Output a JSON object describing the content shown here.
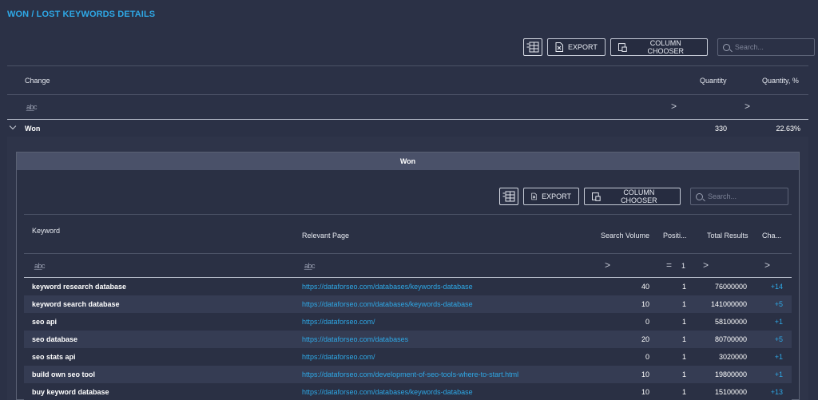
{
  "title": "WON / LOST KEYWORDS DETAILS",
  "outer_toolbar": {
    "export_label": "EXPORT",
    "column_chooser_label": "COLUMN CHOOSER",
    "search_placeholder": "Search..."
  },
  "outer_grid": {
    "columns": {
      "change": "Change",
      "quantity": "Quantity",
      "quantity_pct": "Quantity, %"
    },
    "filter_text_glyph": "a̲b̲c",
    "op_glyph": ">",
    "group": {
      "label": "Won",
      "quantity": "330",
      "quantity_pct": "22.63%"
    }
  },
  "detail": {
    "panel_title": "Won",
    "toolbar": {
      "export_label": "EXPORT",
      "column_chooser_label": "COLUMN CHOOSER",
      "search_placeholder": "Search..."
    },
    "columns": {
      "keyword": "Keyword",
      "relevant_page": "Relevant Page",
      "search_volume": "Search Volume",
      "position": "Positi...",
      "total_results": "Total Results",
      "change": "Cha..."
    },
    "filters": {
      "text_glyph": "a̲b̲c",
      "gt_glyph": ">",
      "eq_glyph": "=",
      "position_value": "1"
    },
    "rows": [
      {
        "keyword": "keyword research database",
        "page": "https://dataforseo.com/databases/keywords-database",
        "search_volume": "40",
        "position": "1",
        "total_results": "76000000",
        "change": "+14"
      },
      {
        "keyword": "keyword search database",
        "page": "https://dataforseo.com/databases/keywords-database",
        "search_volume": "10",
        "position": "1",
        "total_results": "141000000",
        "change": "+5"
      },
      {
        "keyword": "seo api",
        "page": "https://dataforseo.com/",
        "search_volume": "0",
        "position": "1",
        "total_results": "58100000",
        "change": "+1"
      },
      {
        "keyword": "seo database",
        "page": "https://dataforseo.com/databases",
        "search_volume": "20",
        "position": "1",
        "total_results": "80700000",
        "change": "+5"
      },
      {
        "keyword": "seo stats api",
        "page": "https://dataforseo.com/",
        "search_volume": "0",
        "position": "1",
        "total_results": "3020000",
        "change": "+1"
      },
      {
        "keyword": "build own seo tool",
        "page": "https://dataforseo.com/development-of-seo-tools-where-to-start.html",
        "search_volume": "10",
        "position": "1",
        "total_results": "19800000",
        "change": "+1"
      },
      {
        "keyword": "buy keyword database",
        "page": "https://dataforseo.com/databases/keywords-database",
        "search_volume": "10",
        "position": "1",
        "total_results": "15100000",
        "change": "+13"
      }
    ]
  }
}
